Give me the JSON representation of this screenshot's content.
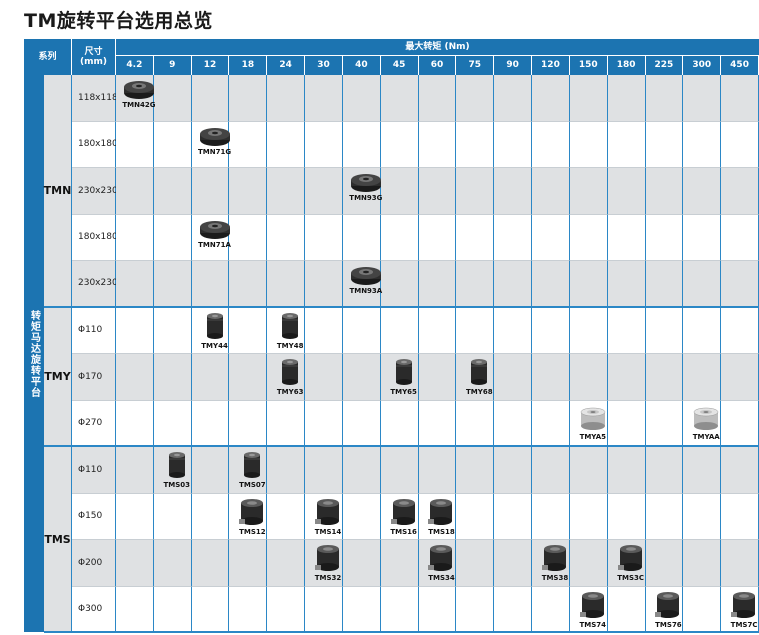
{
  "title": "TM旋转平台选用总览",
  "header": {
    "series_label": "系列",
    "size_label": "尺寸\n(mm)",
    "torque_label": "最大转矩 (Nm)",
    "torque_values": [
      "4.2",
      "9",
      "12",
      "18",
      "24",
      "30",
      "40",
      "45",
      "60",
      "75",
      "90",
      "120",
      "150",
      "180",
      "225",
      "300",
      "450"
    ]
  },
  "series_vertical_label": "转矩马达旋转平台",
  "groups": [
    {
      "name": "TMN",
      "rows": [
        {
          "size": "118x118",
          "products": [
            {
              "col": 0,
              "name": "TMN42G",
              "style": "flat"
            }
          ]
        },
        {
          "size": "180x180",
          "products": [
            {
              "col": 2,
              "name": "TMN71G",
              "style": "flat"
            }
          ]
        },
        {
          "size": "230x230",
          "products": [
            {
              "col": 6,
              "name": "TMN93G",
              "style": "flat"
            }
          ]
        },
        {
          "size": "180x180",
          "products": [
            {
              "col": 2,
              "name": "TMN71A",
              "style": "flat"
            }
          ]
        },
        {
          "size": "230x230",
          "products": [
            {
              "col": 6,
              "name": "TMN93A",
              "style": "flat"
            }
          ]
        }
      ]
    },
    {
      "name": "TMY",
      "rows": [
        {
          "size": "Φ110",
          "products": [
            {
              "col": 2,
              "name": "TMY44",
              "style": "motor"
            },
            {
              "col": 4,
              "name": "TMY48",
              "style": "motor"
            }
          ]
        },
        {
          "size": "Φ170",
          "products": [
            {
              "col": 4,
              "name": "TMY63",
              "style": "motor"
            },
            {
              "col": 7,
              "name": "TMY65",
              "style": "motor"
            },
            {
              "col": 9,
              "name": "TMY68",
              "style": "motor"
            }
          ]
        },
        {
          "size": "Φ270",
          "products": [
            {
              "col": 12,
              "name": "TMYA5",
              "style": "silver"
            },
            {
              "col": 15,
              "name": "TMYAA",
              "style": "silver"
            }
          ]
        }
      ]
    },
    {
      "name": "TMS",
      "rows": [
        {
          "size": "Φ110",
          "products": [
            {
              "col": 1,
              "name": "TMS03",
              "style": "motor"
            },
            {
              "col": 3,
              "name": "TMS07",
              "style": "motor"
            }
          ]
        },
        {
          "size": "Φ150",
          "products": [
            {
              "col": 3,
              "name": "TMS12",
              "style": "big"
            },
            {
              "col": 5,
              "name": "TMS14",
              "style": "big"
            },
            {
              "col": 7,
              "name": "TMS16",
              "style": "big"
            },
            {
              "col": 8,
              "name": "TMS18",
              "style": "big"
            }
          ]
        },
        {
          "size": "Φ200",
          "products": [
            {
              "col": 5,
              "name": "TMS32",
              "style": "big"
            },
            {
              "col": 8,
              "name": "TMS34",
              "style": "big"
            },
            {
              "col": 11,
              "name": "TMS38",
              "style": "big"
            },
            {
              "col": 13,
              "name": "TMS3C",
              "style": "big"
            }
          ]
        },
        {
          "size": "Φ300",
          "products": [
            {
              "col": 12,
              "name": "TMS74",
              "style": "big"
            },
            {
              "col": 14,
              "name": "TMS76",
              "style": "big"
            },
            {
              "col": 16,
              "name": "TMS7C",
              "style": "big"
            }
          ]
        }
      ]
    }
  ],
  "colors": {
    "header_blue": "#1c74b1",
    "row_gray": "#dfe1e3",
    "product_dark": "#2a2a2a"
  }
}
